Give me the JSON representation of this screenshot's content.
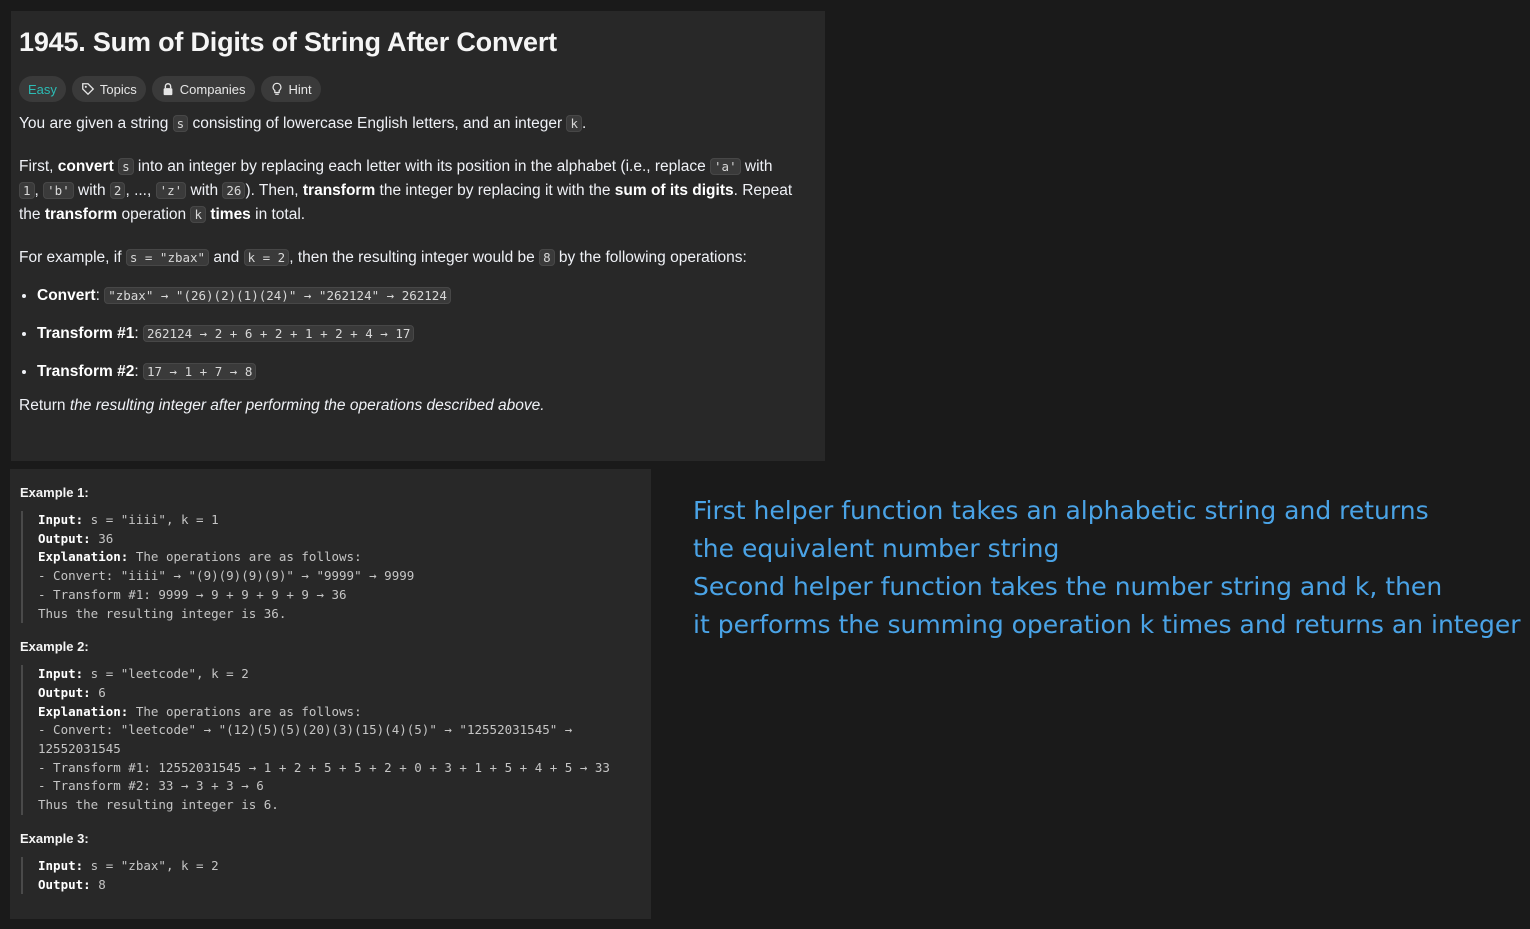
{
  "problem": {
    "title": "1945. Sum of Digits of String After Convert",
    "tags": {
      "difficulty": "Easy",
      "topics": "Topics",
      "companies": "Companies",
      "hint": "Hint"
    },
    "icons": {
      "topics": "tag-icon",
      "companies": "lock-icon",
      "hint": "lightbulb-icon"
    },
    "desc": {
      "p1_a": "You are given a string ",
      "s": "s",
      "p1_b": " consisting of lowercase English letters, and an integer ",
      "k": "k",
      "p1_c": ".",
      "p2_a": "First, ",
      "convert": "convert",
      "p2_b": " into an integer by replacing each letter with its position in the alphabet (i.e., replace ",
      "code_a": "'a'",
      "p2_c": " with",
      "code_1": "1",
      "p2_d": ", ",
      "code_b": "'b'",
      "p2_e": " with ",
      "code_2": "2",
      "p2_f": ", ..., ",
      "code_z": "'z'",
      "p2_g": " with ",
      "code_26": "26",
      "p2_h": "). Then, ",
      "transform": "transform",
      "p2_i": " the integer by replacing it with the ",
      "sum_digits": "sum of its digits",
      "p2_j": ". Repeat",
      "p2_k": "the ",
      "transform2": "transform",
      "p2_l": " operation ",
      "times": "times",
      "p2_m": " in total.",
      "p3_a": "For example, if ",
      "code_s_eq": "s = \"zbax\"",
      "p3_b": " and ",
      "code_k_eq": "k = 2",
      "p3_c": ", then the resulting integer would be ",
      "code_8": "8",
      "p3_d": " by the following operations:",
      "ops": [
        {
          "label": "Convert",
          "sep": ": ",
          "code": "\"zbax\" → \"(26)(2)(1)(24)\" → \"262124\" → 262124"
        },
        {
          "label": "Transform #1",
          "sep": ": ",
          "code": "262124 → 2 + 6 + 2 + 1 + 2 + 4 → 17"
        },
        {
          "label": "Transform #2",
          "sep": ": ",
          "code": "17 → 1 + 7 → 8"
        }
      ],
      "p4_a": "Return ",
      "p4_b": "the resulting integer after performing the operations described above."
    }
  },
  "examples": [
    {
      "title": "Example 1:",
      "input_label": "Input:",
      "input": " s = \"iiii\", k = 1",
      "output_label": "Output:",
      "output": " 36",
      "expl_label": "Explanation:",
      "expl": " The operations are as follows:",
      "lines": [
        "- Convert: \"iiii\" → \"(9)(9)(9)(9)\" → \"9999\" → 9999",
        "- Transform #1: 9999 → 9 + 9 + 9 + 9 → 36",
        "Thus the resulting integer is 36."
      ]
    },
    {
      "title": "Example 2:",
      "input_label": "Input:",
      "input": " s = \"leetcode\", k = 2",
      "output_label": "Output:",
      "output": " 6",
      "expl_label": "Explanation:",
      "expl": " The operations are as follows:",
      "lines": [
        "- Convert: \"leetcode\" → \"(12)(5)(5)(20)(3)(15)(4)(5)\" → \"12552031545\" →",
        "12552031545",
        "- Transform #1: 12552031545 → 1 + 2 + 5 + 5 + 2 + 0 + 3 + 1 + 5 + 4 + 5 → 33",
        "- Transform #2: 33 → 3 + 3 → 6",
        "Thus the resulting integer is 6."
      ]
    },
    {
      "title": "Example 3:",
      "input_label": "Input:",
      "input": " s = \"zbax\", k = 2",
      "output_label": "Output:",
      "output": " 8"
    }
  ],
  "notes": [
    "First helper function takes an alphabetic string and returns",
    "the equivalent number string",
    "Second helper function takes the number string and k, then",
    "it performs the summing operation k times and returns an integer"
  ],
  "colors": {
    "accent_easy": "#2cbbb4",
    "notes": "#4aa3e6",
    "panel": "#282828",
    "background": "#1a1a1a"
  }
}
